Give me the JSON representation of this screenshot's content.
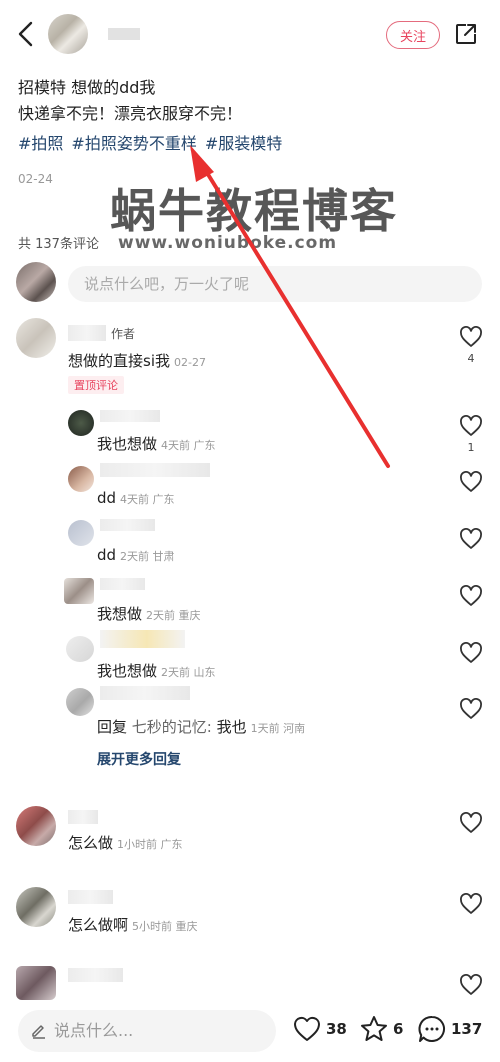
{
  "header": {
    "follow_label": "关注"
  },
  "post": {
    "line1": "招模特 想做的dd我",
    "line2": "快递拿不完！漂亮衣服穿不完！",
    "tags": [
      "#拍照",
      "#拍照姿势不重样",
      "#服装模特"
    ],
    "date": "02-24"
  },
  "watermark": {
    "big": "蜗牛教程博客",
    "small": "www.woniubоke.com"
  },
  "comments_section": {
    "count_label": "共 137条评论",
    "input_placeholder": "说点什么吧，万一火了呢"
  },
  "comments": [
    {
      "author_tag": "作者",
      "text": "想做的直接si我",
      "meta": "02-27",
      "pinned_label": "置顶评论",
      "likes": "4"
    }
  ],
  "replies": [
    {
      "text": "我也想做",
      "meta": "4天前 广东",
      "likes": "1"
    },
    {
      "text": "dd",
      "meta": "4天前 广东",
      "likes": ""
    },
    {
      "text": "dd",
      "meta": "2天前 甘肃",
      "likes": ""
    },
    {
      "text": "我想做",
      "meta": "2天前 重庆",
      "likes": ""
    },
    {
      "text": "我也想做",
      "meta": "2天前 山东",
      "likes": ""
    },
    {
      "prefix": "回复",
      "reply_to": "七秒的记忆:",
      "text": "我也",
      "meta": "1天前 河南",
      "likes": ""
    }
  ],
  "expand_label": "展开更多回复",
  "more_comments": [
    {
      "text": "怎么做",
      "meta": "1小时前 广东"
    },
    {
      "text": "怎么做啊",
      "meta": "5小时前 重庆"
    }
  ],
  "bottom": {
    "input_placeholder": "说点什么...",
    "likes": "38",
    "stars": "6",
    "comments": "137"
  },
  "colors": {
    "accent": "#e8455f",
    "tag": "#25476e",
    "arrow": "#e8302f"
  }
}
